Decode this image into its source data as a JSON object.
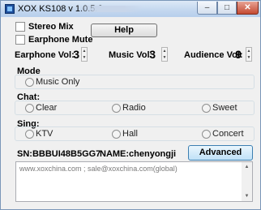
{
  "window": {
    "title": "XOX KS108 v 1.0.5.6",
    "controls": {
      "minimize": "–",
      "maximize": "□",
      "close": "✕"
    }
  },
  "options": {
    "stereo_mix": "Stereo Mix",
    "earphone_mute": "Earphone Mute"
  },
  "help_label": "Help",
  "volumes": {
    "earphone": {
      "label": "Earphone Vol:",
      "value": "3"
    },
    "music": {
      "label": "Music Vol:",
      "value": "3"
    },
    "audience": {
      "label": "Audience Vol:",
      "value": "9"
    }
  },
  "mode": {
    "label": "Mode",
    "options": [
      "Music Only"
    ]
  },
  "chat": {
    "label": "Chat:",
    "options": [
      "Clear",
      "Radio",
      "Sweet"
    ]
  },
  "sing": {
    "label": "Sing:",
    "options": [
      "KTV",
      "Hall",
      "Concert"
    ]
  },
  "info": {
    "sn": "SN:BBBUI48B5GG7",
    "name": "NAME:chenyongji"
  },
  "advanced_label": "Advanced Mode",
  "footer_text": "www.xoxchina.com ; sale@xoxchina.com(global)"
}
